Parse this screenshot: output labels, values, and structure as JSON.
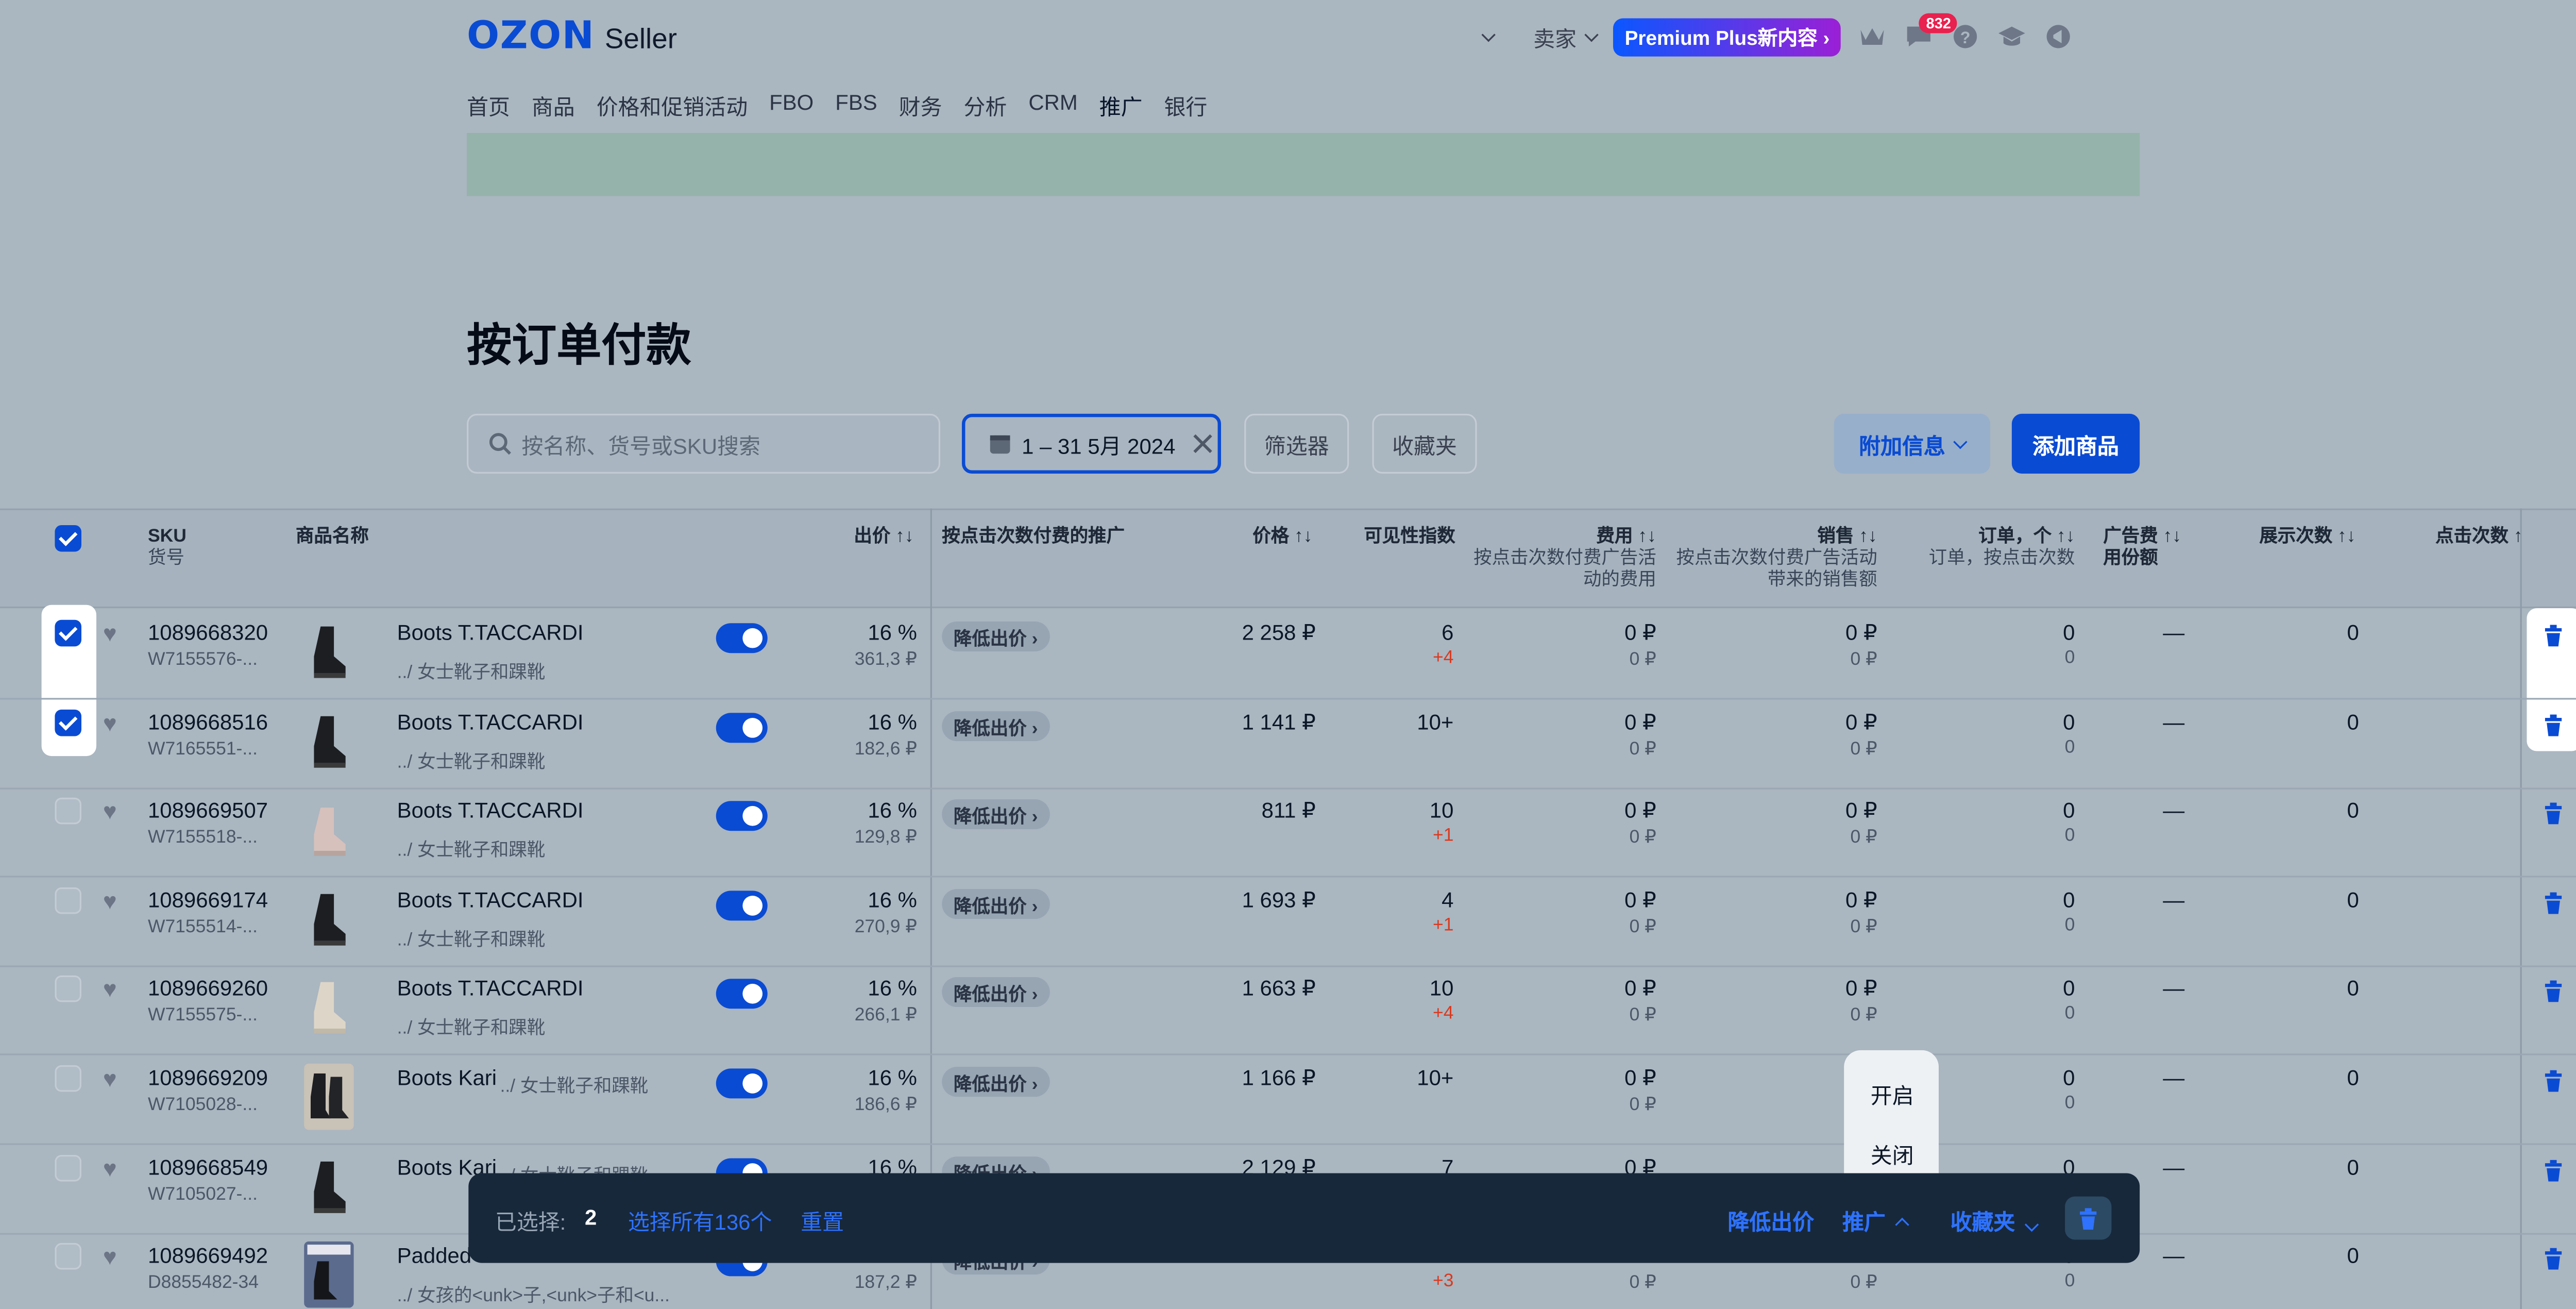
{
  "header": {
    "logo_main": "OZON",
    "logo_sub": "Seller",
    "seller_menu": "卖家",
    "premium_badge": "Premium Plus新内容",
    "messages_count": "832",
    "icons": [
      "chevron-down-icon",
      "crown-icon",
      "chat-icon",
      "help-icon",
      "graduation-cap-icon",
      "megaphone-icon"
    ]
  },
  "nav": {
    "items": [
      "首页",
      "商品",
      "价格和促销活动",
      "FBO",
      "FBS",
      "财务",
      "分析",
      "CRM",
      "推广",
      "银行"
    ],
    "active": "推广"
  },
  "page_title": "按订单付款",
  "toolbar": {
    "search_placeholder": "按名称、货号或SKU搜索",
    "date_range": "1 – 31 5月 2024",
    "filters": "筛选器",
    "favorites": "收藏夹",
    "more_info": "附加信息",
    "add_product": "添加商品"
  },
  "table": {
    "headers": {
      "sku": "SKU",
      "article": "货号",
      "product_name": "商品名称",
      "bid": "出价 ↑↓",
      "cpc_promo": "按点击次数付费的推广",
      "price": "价格 ↑↓",
      "visibility": "可见性指数",
      "cost": "费用 ↑↓",
      "cost_sub1": "按点击次数付费广告活",
      "cost_sub2": "动的费用",
      "sales": "销售 ↑↓",
      "sales_sub1": "按点击次数付费广告活动",
      "sales_sub2": "带来的销售额",
      "orders": "订单，个 ↑↓",
      "orders_sub": "订单，按点击次数",
      "ad_share_1": "广告费 ↑↓",
      "ad_share_2": "用份额",
      "impressions": "展示次数 ↑↓",
      "clicks": "点击次数 ↑"
    },
    "rows": [
      {
        "checked": true,
        "sku": "1089668320",
        "article": "W7155576-...",
        "name": "Boots T.TACCARDI",
        "category": "../ 女士靴子和踝靴",
        "bid": "16 %",
        "bid_sub": "361,3 ₽",
        "promo": "降低出价",
        "price": "2 258 ₽",
        "visibility": "6",
        "visibility_delta": "+4",
        "cost": "0 ₽",
        "cost_sub": "0 ₽",
        "sales": "0 ₽",
        "sales_sub": "0 ₽",
        "orders": "0",
        "orders_sub": "0",
        "ad_share": "—",
        "impressions": "0",
        "thumb": "black"
      },
      {
        "checked": true,
        "sku": "1089668516",
        "article": "W7165551-...",
        "name": "Boots T.TACCARDI",
        "category": "../ 女士靴子和踝靴",
        "bid": "16 %",
        "bid_sub": "182,6 ₽",
        "promo": "降低出价",
        "price": "1 141 ₽",
        "visibility": "10+",
        "visibility_delta": "",
        "cost": "0 ₽",
        "cost_sub": "0 ₽",
        "sales": "0 ₽",
        "sales_sub": "0 ₽",
        "orders": "0",
        "orders_sub": "0",
        "ad_share": "—",
        "impressions": "0",
        "thumb": "black"
      },
      {
        "checked": false,
        "sku": "1089669507",
        "article": "W7155518-...",
        "name": "Boots T.TACCARDI",
        "category": "../ 女士靴子和踝靴",
        "bid": "16 %",
        "bid_sub": "129,8 ₽",
        "promo": "降低出价",
        "price": "811 ₽",
        "visibility": "10",
        "visibility_delta": "+1",
        "cost": "0 ₽",
        "cost_sub": "0 ₽",
        "sales": "0 ₽",
        "sales_sub": "0 ₽",
        "orders": "0",
        "orders_sub": "0",
        "ad_share": "—",
        "impressions": "0",
        "thumb": "pink"
      },
      {
        "checked": false,
        "sku": "1089669174",
        "article": "W7155514-...",
        "name": "Boots T.TACCARDI",
        "category": "../ 女士靴子和踝靴",
        "bid": "16 %",
        "bid_sub": "270,9 ₽",
        "promo": "降低出价",
        "price": "1 693 ₽",
        "visibility": "4",
        "visibility_delta": "+1",
        "cost": "0 ₽",
        "cost_sub": "0 ₽",
        "sales": "0 ₽",
        "sales_sub": "0 ₽",
        "orders": "0",
        "orders_sub": "0",
        "ad_share": "—",
        "impressions": "0",
        "thumb": "black"
      },
      {
        "checked": false,
        "sku": "1089669260",
        "article": "W7155575-...",
        "name": "Boots T.TACCARDI",
        "category": "../ 女士靴子和踝靴",
        "bid": "16 %",
        "bid_sub": "266,1 ₽",
        "promo": "降低出价",
        "price": "1 663 ₽",
        "visibility": "10",
        "visibility_delta": "+4",
        "cost": "0 ₽",
        "cost_sub": "0 ₽",
        "sales": "0 ₽",
        "sales_sub": "0 ₽",
        "orders": "0",
        "orders_sub": "0",
        "ad_share": "—",
        "impressions": "0",
        "thumb": "beige"
      },
      {
        "checked": false,
        "sku": "1089669209",
        "article": "W7105028-...",
        "name": "Boots Kari",
        "category": "../ 女士靴子和踝靴",
        "bid": "16 %",
        "bid_sub": "186,6 ₽",
        "promo": "降低出价",
        "price": "1 166 ₽",
        "visibility": "10+",
        "visibility_delta": "",
        "cost": "0 ₽",
        "cost_sub": "0 ₽",
        "sales": "",
        "sales_sub": "",
        "orders": "0",
        "orders_sub": "0",
        "ad_share": "—",
        "impressions": "0",
        "thumb": "photo"
      },
      {
        "checked": false,
        "sku": "1089668549",
        "article": "W7105027-...",
        "name": "Boots Kari",
        "category": "../ 女士靴子和踝靴",
        "bid": "16 %",
        "bid_sub": "",
        "promo": "降低出价",
        "price": "2 129 ₽",
        "visibility": "7",
        "visibility_delta": "",
        "cost": "0 ₽",
        "cost_sub": "",
        "sales": "",
        "sales_sub": "",
        "orders": "0",
        "orders_sub": "",
        "ad_share": "—",
        "impressions": "0",
        "thumb": "black"
      },
      {
        "checked": false,
        "sku": "1089669492",
        "article": "D8855482-34",
        "name": "Padded",
        "category": "../ 女孩的<unk>子,<unk>子和<u...",
        "bid": "",
        "bid_sub": "187,2 ₽",
        "promo": "降低出价",
        "price": "",
        "visibility": "",
        "visibility_delta": "+3",
        "cost": "",
        "cost_sub": "0 ₽",
        "sales": "",
        "sales_sub": "0 ₽",
        "orders": "0",
        "orders_sub": "0",
        "ad_share": "—",
        "impressions": "0",
        "thumb": "magazine"
      }
    ]
  },
  "popup": {
    "on": "开启",
    "off": "关闭"
  },
  "bottom_bar": {
    "selected_label": "已选择:",
    "selected_count": "2",
    "select_all": "选择所有136个",
    "reset": "重置",
    "lower_bid": "降低出价",
    "promote": "推广",
    "favorites": "收藏夹"
  },
  "colors": {
    "accent": "#0a4bd3",
    "bar": "#17283b",
    "delta": "#d93a1f"
  }
}
